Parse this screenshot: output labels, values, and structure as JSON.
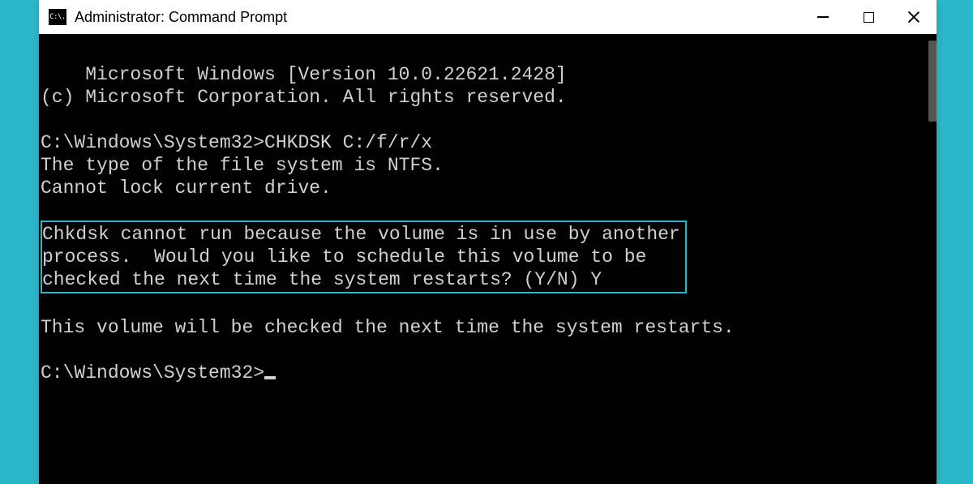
{
  "window": {
    "title": "Administrator: Command Prompt",
    "icon_label": "C:\\."
  },
  "terminal": {
    "header_line1": "Microsoft Windows [Version 10.0.22621.2428]",
    "header_line2": "(c) Microsoft Corporation. All rights reserved.",
    "blank": "",
    "prompt1": "C:\\Windows\\System32>CHKDSK C:/f/r/x",
    "response1": "The type of the file system is NTFS.",
    "response2": "Cannot lock current drive.",
    "highlight_line1": "Chkdsk cannot run because the volume is in use by another",
    "highlight_line2": "process.  Would you like to schedule this volume to be",
    "highlight_line3": "checked the next time the system restarts? (Y/N) Y",
    "response3": "This volume will be checked the next time the system restarts.",
    "prompt2": "C:\\Windows\\System32>"
  }
}
